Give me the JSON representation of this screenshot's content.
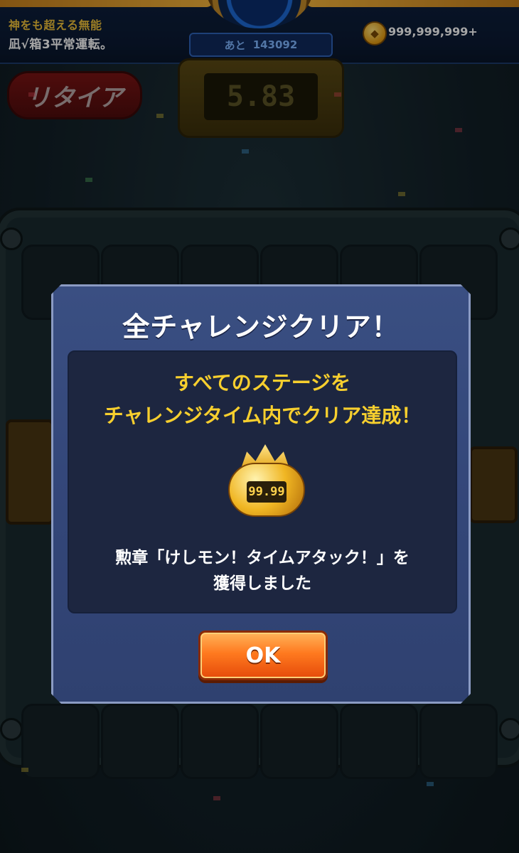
{
  "hud": {
    "player_title": "神をも超える無能",
    "player_name": "凪√箱3平常運転。",
    "remaining_label": "あと",
    "remaining_value": "143092",
    "currency_value": "999,999,999+"
  },
  "game": {
    "retire_label": "リタイア",
    "timer_value": "5.83"
  },
  "dialog": {
    "title": "全チャレンジクリア！",
    "message_line1": "すべてのステージを",
    "message_line2": "チャレンジタイム内でクリア達成！",
    "medal_time": "99.99",
    "award_line1": "勲章「けしモン！タイムアタック！」を",
    "award_line2": "獲得しました",
    "ok_label": "OK"
  },
  "colors": {
    "message_yellow": "#f7cf2e",
    "dialog_blue": "#34477a",
    "ok_orange": "#ff7a1f"
  }
}
